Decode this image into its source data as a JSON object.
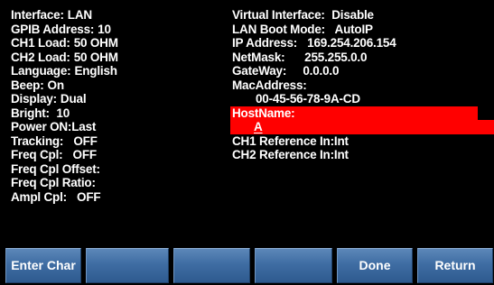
{
  "left_column": [
    {
      "label": "Interface:",
      "value": "LAN"
    },
    {
      "label": "GPIB Address:",
      "value": "10"
    },
    {
      "label": "CH1 Load:",
      "value": "50 OHM"
    },
    {
      "label": "CH2 Load:",
      "value": "50 OHM"
    },
    {
      "label": "Language:",
      "value": "English"
    },
    {
      "label": "Beep:",
      "value": "On"
    },
    {
      "label": "Display:",
      "value": "Dual"
    },
    {
      "label": "Bright:",
      "value": " 10"
    },
    {
      "label": "Power ON:",
      "value": "Last"
    },
    {
      "label": "Tracking:",
      "value": "  OFF"
    },
    {
      "label": "Freq Cpl:",
      "value": "  OFF"
    },
    {
      "label": "Freq Cpl Offset:",
      "value": ""
    },
    {
      "label": "Freq Cpl Ratio:",
      "value": ""
    },
    {
      "label": "Ampl Cpl:",
      "value": "  OFF"
    }
  ],
  "right_column": {
    "virtual_interface": {
      "label": "Virtual Interface:",
      "value": " Disable"
    },
    "lan_boot_mode": {
      "label": "LAN Boot Mode:",
      "value": "  AutoIP"
    },
    "ip_address": {
      "label": "IP Address:",
      "value": "  169.254.206.154"
    },
    "netmask": {
      "label": "NetMask:",
      "value": "     255.255.0.0"
    },
    "gateway": {
      "label": "GateWay:",
      "value": "    0.0.0.0"
    },
    "mac_address": {
      "label": "MacAddress:",
      "value": "00-45-56-78-9A-CD"
    },
    "hostname": {
      "label": "HostName:",
      "value": "A"
    },
    "ch1_reference": {
      "label": "CH1 Reference In:",
      "value": "Int"
    },
    "ch2_reference": {
      "label": "CH2 Reference In:",
      "value": "Int"
    }
  },
  "softkeys": {
    "key1": "Enter Char",
    "key2": "",
    "key3": "",
    "key4": "",
    "key5": "Done",
    "key6": "Return"
  },
  "colors": {
    "background": "#000000",
    "text": "#ffffff",
    "highlight": "#ff0000",
    "softkey": "#3f6da3"
  }
}
